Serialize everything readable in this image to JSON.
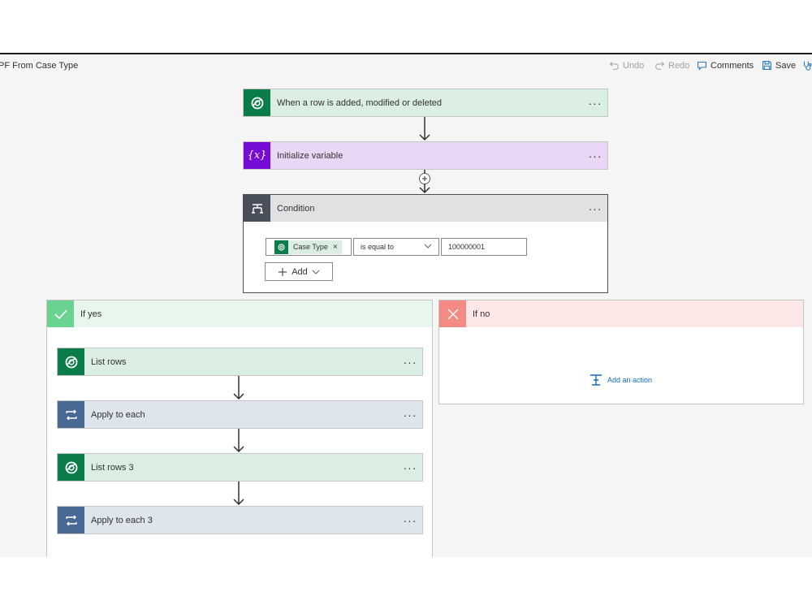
{
  "header": {
    "flow_title": "PF From Case Type",
    "undo": "Undo",
    "redo": "Redo",
    "comments": "Comments",
    "save": "Save"
  },
  "steps": {
    "trigger": {
      "label": "When a row is added, modified or deleted",
      "icon": "dataverse-icon",
      "more": "···"
    },
    "init_var": {
      "label": "Initialize variable",
      "icon": "variable-icon",
      "icon_text": "{x}",
      "more": "···"
    },
    "condition": {
      "label": "Condition",
      "icon": "condition-icon",
      "more": "···",
      "left_token": "Case Type",
      "token_remove": "×",
      "operator": "is equal to",
      "value": "100000001",
      "add_label": "Add"
    }
  },
  "branches": {
    "yes": {
      "label": "If yes",
      "color": "#6bd392",
      "actions": [
        {
          "label": "List rows",
          "icon": "dataverse-icon",
          "more": "···"
        },
        {
          "label": "Apply to each",
          "icon": "loop-icon",
          "more": "···"
        },
        {
          "label": "List rows 3",
          "icon": "dataverse-icon",
          "more": "···"
        },
        {
          "label": "Apply to each 3",
          "icon": "loop-icon",
          "more": "···"
        }
      ]
    },
    "no": {
      "label": "If no",
      "color": "#f48a84",
      "add_action": "Add an action"
    }
  },
  "colors": {
    "dataverse": "#0a7c4a",
    "variable": "#770bd6",
    "condition": "#484f58",
    "loop": "#486991",
    "link": "#0f6cbd"
  }
}
